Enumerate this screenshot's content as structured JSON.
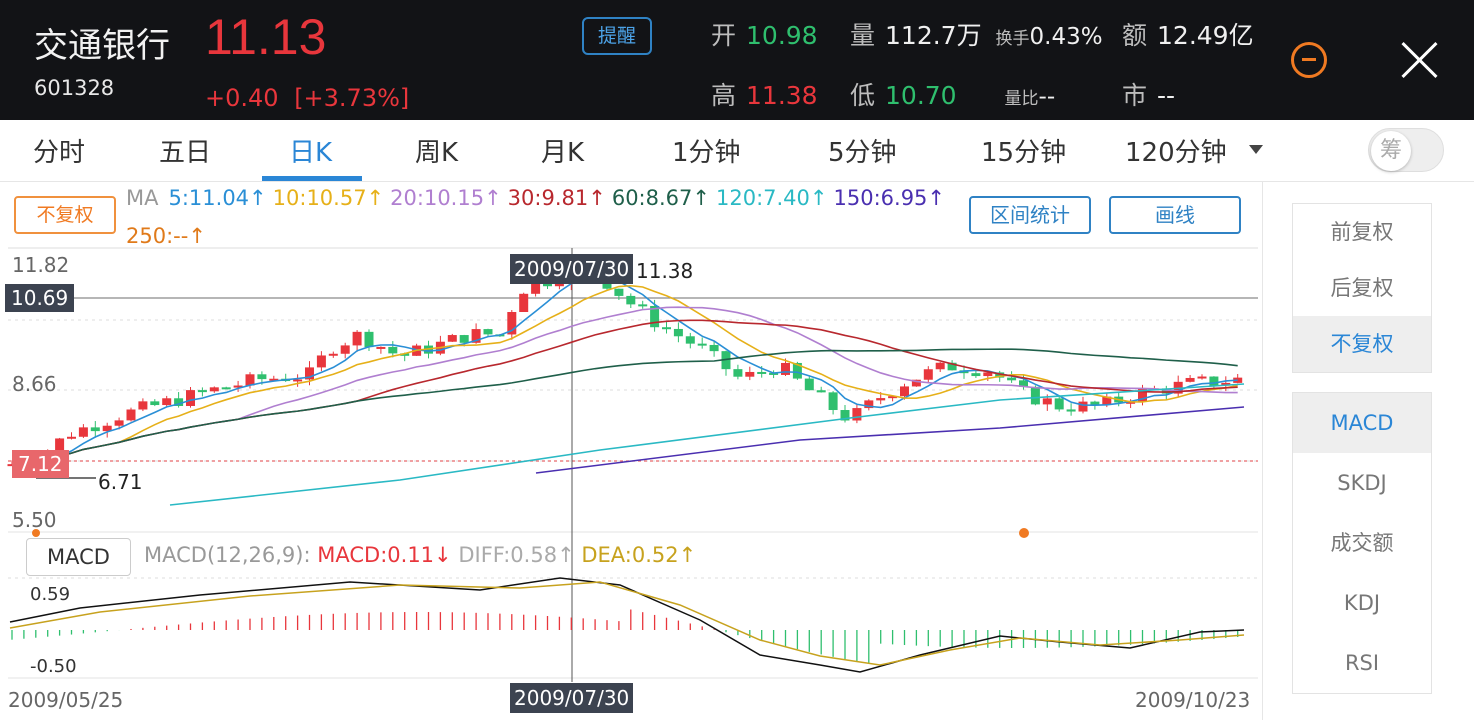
{
  "header": {
    "name": "交通银行",
    "code": "601328",
    "price": "11.13",
    "change": "+0.40",
    "change_pct": "[+3.73%]",
    "remind_label": "提醒",
    "open_label": "开",
    "open_value": "10.98",
    "volume_label": "量",
    "volume_value": "112.7万",
    "turnover_label": "换手",
    "turnover_value": "0.43%",
    "amount_label": "额",
    "amount_value": "12.49亿",
    "high_label": "高",
    "high_value": "11.38",
    "low_label": "低",
    "low_value": "10.70",
    "vol_ratio_label": "量比",
    "vol_ratio_value": "--",
    "market_label": "市",
    "market_value": "--"
  },
  "tabs": [
    "分时",
    "五日",
    "日K",
    "周K",
    "月K",
    "1分钟",
    "5分钟",
    "15分钟",
    "120分钟"
  ],
  "active_tab": "日K",
  "toggle_label": "筹",
  "chart": {
    "fq_button": "不复权",
    "ma_prefix": "MA",
    "ma": [
      {
        "text": "5:11.04↑",
        "color": "#2a8fd6"
      },
      {
        "text": "10:10.57↑",
        "color": "#e6b019"
      },
      {
        "text": "20:10.15↑",
        "color": "#b07fd0"
      },
      {
        "text": "30:9.81↑",
        "color": "#b8282e"
      },
      {
        "text": "60:8.67↑",
        "color": "#1f5f4a"
      },
      {
        "text": "120:7.40↑",
        "color": "#2ab9c4"
      },
      {
        "text": "150:6.95↑",
        "color": "#4a2fb0"
      }
    ],
    "ma250": {
      "text": "250:--↑",
      "color": "#e07a1a"
    },
    "range_stats_button": "区间统计",
    "draw_button": "画线",
    "y_top": "11.82",
    "y_mid": "8.66",
    "y_bottom": "5.50",
    "crosshair_price": "10.69",
    "crosshair_date": "2009/07/30",
    "high_marker": "11.38",
    "low_marker": "6.71",
    "left_price_tag": "7.12",
    "macd": {
      "button": "MACD",
      "params": "MACD(12,26,9):",
      "macd_text": "MACD:0.11↓",
      "diff_text": "DIFF:0.58↑",
      "dea_text": "DEA:0.52↑",
      "y_top": "0.59",
      "y_bottom": "-0.50"
    },
    "x_start": "2009/05/25",
    "x_end": "2009/10/23"
  },
  "right_panel": {
    "fq_options": [
      "前复权",
      "后复权",
      "不复权"
    ],
    "fq_selected": "不复权",
    "indicators": [
      "MACD",
      "SKDJ",
      "成交额",
      "KDJ",
      "RSI"
    ],
    "indicator_selected": "MACD"
  },
  "colors": {
    "up": "#e8363c",
    "down": "#2fbf6e",
    "accent": "#2a86d6"
  },
  "chart_data": {
    "type": "candlestick",
    "x_range": [
      "2009/05/25",
      "2009/10/23"
    ],
    "ylim": [
      5.5,
      11.82
    ],
    "macd_ylim": [
      -0.5,
      0.59
    ]
  }
}
